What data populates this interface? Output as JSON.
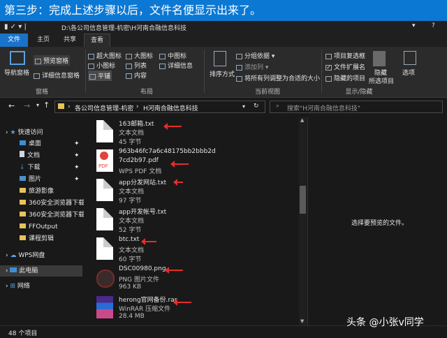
{
  "banner": {
    "text": "第三步：完成上述步骤以后，文件名便显示出来了。"
  },
  "window": {
    "path": "D:\\各公司信息管理-机密\\H河南合融信息科技"
  },
  "tabs": [
    "文件",
    "主页",
    "共享",
    "查看"
  ],
  "ribbon": {
    "panes": {
      "nav_pane": "导航窗格",
      "preview_pane": "预览窗格",
      "details_pane": "详细信息窗格",
      "group": "窗格"
    },
    "layout": {
      "xlarge": "超大图标",
      "large": "大图标",
      "medium": "中图标",
      "small": "小图标",
      "list": "列表",
      "details": "详细信息",
      "tiles": "平铺",
      "content": "内容",
      "group": "布局"
    },
    "current_view": {
      "sort": "排序方式",
      "group_by": "分组依据",
      "add_column": "添加列",
      "size_cols": "将所有列调整为合适的大小",
      "group": "当前视图"
    },
    "show_hide": {
      "item_checkbox": "项目复选框",
      "file_ext": "文件扩展名",
      "hidden_items": "隐藏的项目",
      "hide": "隐藏",
      "hide_selected": "所选项目",
      "options": "选项",
      "group": "显示/隐藏"
    }
  },
  "breadcrumb": [
    "各公司信息管理-机密",
    "H河南合融信息科技"
  ],
  "search": {
    "placeholder": "搜索\"H河南合融信息科技\""
  },
  "sidebar": {
    "items": [
      {
        "label": "快速访问"
      },
      {
        "label": "桌面"
      },
      {
        "label": "文档"
      },
      {
        "label": "下载"
      },
      {
        "label": "图片"
      },
      {
        "label": "旅游影像"
      },
      {
        "label": "360安全浏览器下载"
      },
      {
        "label": "360安全浏览器下载"
      },
      {
        "label": "FFOutput"
      },
      {
        "label": "课程剪辑"
      },
      {
        "label": "WPS网盘"
      },
      {
        "label": "此电脑"
      },
      {
        "label": "网络"
      }
    ]
  },
  "files": [
    {
      "name": "163邮箱.txt",
      "type": "文本文档",
      "size": "45 字节",
      "icon": "txt"
    },
    {
      "name": "963b46fc7a6c48175bb2bbb2d7cd2b97.pdf",
      "name1": "963b46fc7a6c48175bb2bbb2d",
      "name2": "7cd2b97.pdf",
      "type": "WPS PDF 文档",
      "size": "",
      "icon": "pdf",
      "icon_label": "PDF"
    },
    {
      "name": "app分发网站.txt",
      "type": "文本文档",
      "size": "97 字节",
      "icon": "txt"
    },
    {
      "name": "app开发帐号.txt",
      "type": "文本文档",
      "size": "52 字节",
      "icon": "txt"
    },
    {
      "name": "btc.txt",
      "type": "文本文档",
      "size": "60 字节",
      "icon": "txt"
    },
    {
      "name": "DSC00980.png",
      "type": "PNG 图片文件",
      "size": "963 KB",
      "icon": "png"
    },
    {
      "name": "herong官网备份.rar",
      "type": "WinRAR 压缩文件",
      "size": "28.4 MB",
      "icon": "rar"
    }
  ],
  "preview": {
    "message": "选择要预览的文件。"
  },
  "status": {
    "count": "48 个项目"
  },
  "watermark": {
    "text": "头条 @小张v同学"
  },
  "colors": {
    "accent": "#0b78d4",
    "arrow": "#e52d2d"
  }
}
